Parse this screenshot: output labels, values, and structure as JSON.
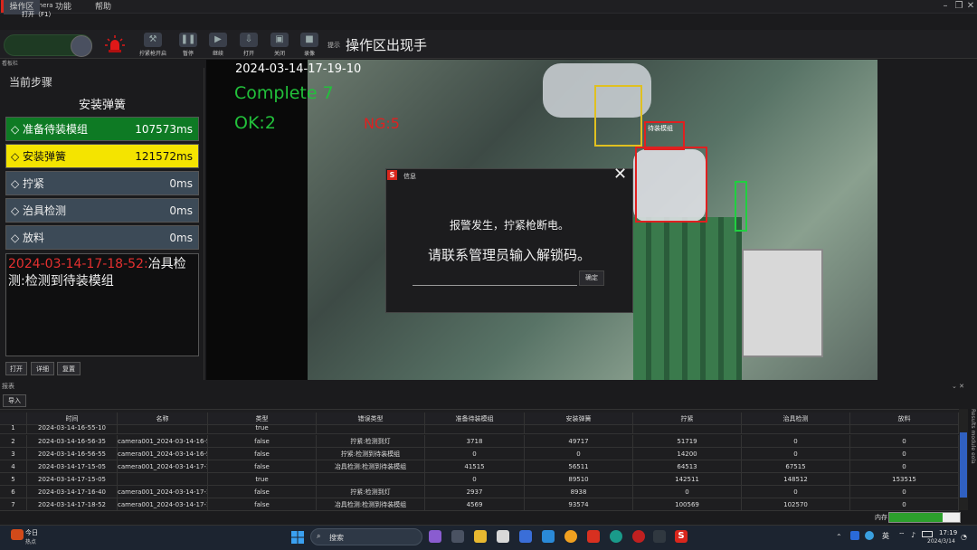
{
  "app": {
    "title": "AI Camera",
    "logo_letter": "S"
  },
  "menu": [
    {
      "label": "操作区",
      "active": true
    },
    {
      "label": "功能"
    },
    {
      "label": "帮助"
    }
  ],
  "toolbar": {
    "start_label": "打开（F1）",
    "buttons": [
      {
        "label": "拧紧枪开启",
        "icon": "screwdriver-icon"
      },
      {
        "label": "暂停",
        "icon": "pause-icon"
      },
      {
        "label": "继续",
        "icon": "resume-icon"
      },
      {
        "label": "打开",
        "icon": "open-icon"
      },
      {
        "label": "关闭",
        "icon": "close-video-icon"
      },
      {
        "label": "录像",
        "icon": "camera-icon"
      }
    ],
    "hint_label": "提示",
    "hint_text": "操作区出现手"
  },
  "left_panel": {
    "header": "看板栏",
    "current_step_label": "当前步骤",
    "current_step_name": "安装弹簧",
    "steps": [
      {
        "name": "准备待装模组",
        "ms": "107573ms",
        "state": "done",
        "color": "#0e7a24"
      },
      {
        "name": "安装弹簧",
        "ms": "121572ms",
        "state": "current",
        "color": "#f4e400"
      },
      {
        "name": "拧紧",
        "ms": "0ms",
        "state": "pending",
        "color": "#3c4a57"
      },
      {
        "name": "治具检测",
        "ms": "0ms",
        "state": "pending",
        "color": "#3c4a57"
      },
      {
        "name": "放料",
        "ms": "0ms",
        "state": "pending",
        "color": "#3c4a57"
      }
    ],
    "log": {
      "timestamp": "2024-03-14-17-18-52:",
      "text": "冶具检测:检测到待装模组"
    },
    "buttons": [
      "打开",
      "详细",
      "复置"
    ]
  },
  "video": {
    "timestamp": "2024-03-14-17-19-10",
    "complete": "Complete 7",
    "ok": "OK:2",
    "ng": "NG:5",
    "detection_label": "待装模组"
  },
  "dialog": {
    "title": "信息",
    "message1": "报警发生，拧紧枪断电。",
    "message2": "请联系管理员输入解锁码。",
    "input_value": "",
    "ok_label": "确定"
  },
  "report": {
    "header": "报表",
    "import_label": "导入",
    "columns": [
      "",
      "时间",
      "名称",
      "类型",
      "错误类型",
      "准备待装模组",
      "安装弹簧",
      "拧紧",
      "治具检测",
      "放料"
    ],
    "rows": [
      [
        "1",
        "2024-03-14-16-55-10",
        "",
        "true",
        "",
        "",
        "",
        "",
        "",
        ""
      ],
      [
        "2",
        "2024-03-14-16-56-35",
        "camera001_2024-03-14-16-5...",
        "false",
        "拧紧:检测到灯",
        "3718",
        "49717",
        "51719",
        "0",
        "0"
      ],
      [
        "3",
        "2024-03-14-16-56-55",
        "camera001_2024-03-14-16-5...",
        "false",
        "拧紧:检测到待装模组",
        "0",
        "0",
        "14200",
        "0",
        "0"
      ],
      [
        "4",
        "2024-03-14-17-15-05",
        "camera001_2024-03-14-17-1...",
        "false",
        "冶具检测:检测到待装模组",
        "41515",
        "56511",
        "64513",
        "67515",
        "0"
      ],
      [
        "5",
        "2024-03-14-17-15-05",
        "",
        "true",
        "",
        "0",
        "89510",
        "142511",
        "148512",
        "153515"
      ],
      [
        "6",
        "2024-03-14-17-16-40",
        "camera001_2024-03-14-17-1...",
        "false",
        "拧紧:检测到灯",
        "2937",
        "8938",
        "0",
        "0",
        "0"
      ],
      [
        "7",
        "2024-03-14-17-18-52",
        "camera001_2024-03-14-17-1...",
        "false",
        "冶具检测:检测到待装模组",
        "4569",
        "93574",
        "100569",
        "102570",
        "0"
      ]
    ],
    "side_tabs": "Results module  eola"
  },
  "status": {
    "memory_label": "内存",
    "memory_fraction": 0.75
  },
  "taskbar": {
    "weather_title": "今日",
    "weather_sub": "热点",
    "search_label": "搜索",
    "lang": "英",
    "time": "17:19",
    "date": "2024/3/14"
  }
}
